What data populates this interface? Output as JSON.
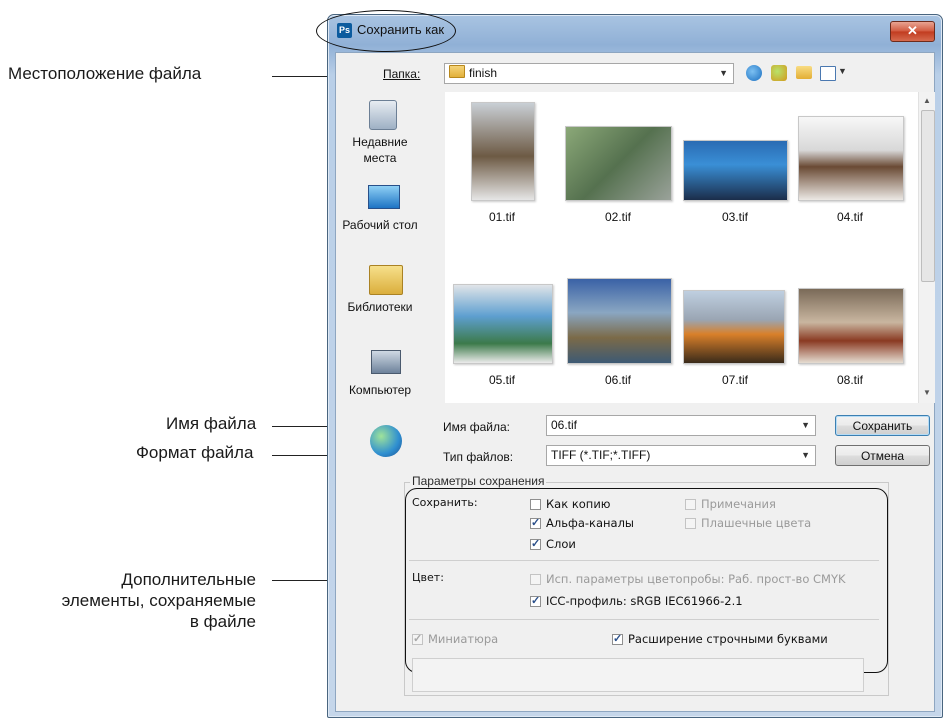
{
  "callouts": {
    "location": "Местоположение файла",
    "filename": "Имя файла",
    "format": "Формат файла",
    "extra_line1": "Дополнительные",
    "extra_line2": "элементы, сохраняемые",
    "extra_line3": "в файле"
  },
  "window": {
    "title": "Сохранить как",
    "app_icon_text": "Ps",
    "close_glyph": "✕"
  },
  "location": {
    "label": "Папка:",
    "value": "finish"
  },
  "places": [
    {
      "label": "Недавние места"
    },
    {
      "label": "Рабочий стол"
    },
    {
      "label": "Библиотеки"
    },
    {
      "label": "Компьютер"
    }
  ],
  "files": [
    "01.tif",
    "02.tif",
    "03.tif",
    "04.tif",
    "05.tif",
    "06.tif",
    "07.tif",
    "08.tif"
  ],
  "filename": {
    "label": "Имя файла:",
    "value": "06.tif"
  },
  "filetype": {
    "label": "Тип файлов:",
    "value": "TIFF (*.TIF;*.TIFF)"
  },
  "buttons": {
    "save": "Сохранить",
    "cancel": "Отмена"
  },
  "save_options": {
    "group_title": "Параметры сохранения",
    "save_label": "Сохранить:",
    "as_copy": "Как копию",
    "notes": "Примечания",
    "alpha": "Альфа-каналы",
    "spot": "Плашечные цвета",
    "layers": "Слои",
    "color_label": "Цвет:",
    "proof": "Исп. параметры цветопробы:  Раб. прост-во CMYK",
    "icc": "ICC-профиль:  sRGB IEC61966-2.1",
    "thumbnail": "Миниатюра",
    "lowercase": "Расширение строчными буквами"
  },
  "state": {
    "as_copy": false,
    "notes": false,
    "alpha": true,
    "spot": false,
    "layers": true,
    "proof": false,
    "icc": true,
    "thumbnail": true,
    "lowercase": true
  },
  "colors": {
    "accent": "#3c7fb1",
    "title_gradient_top": "#a9c4e2",
    "close_red": "#c13b1f"
  }
}
